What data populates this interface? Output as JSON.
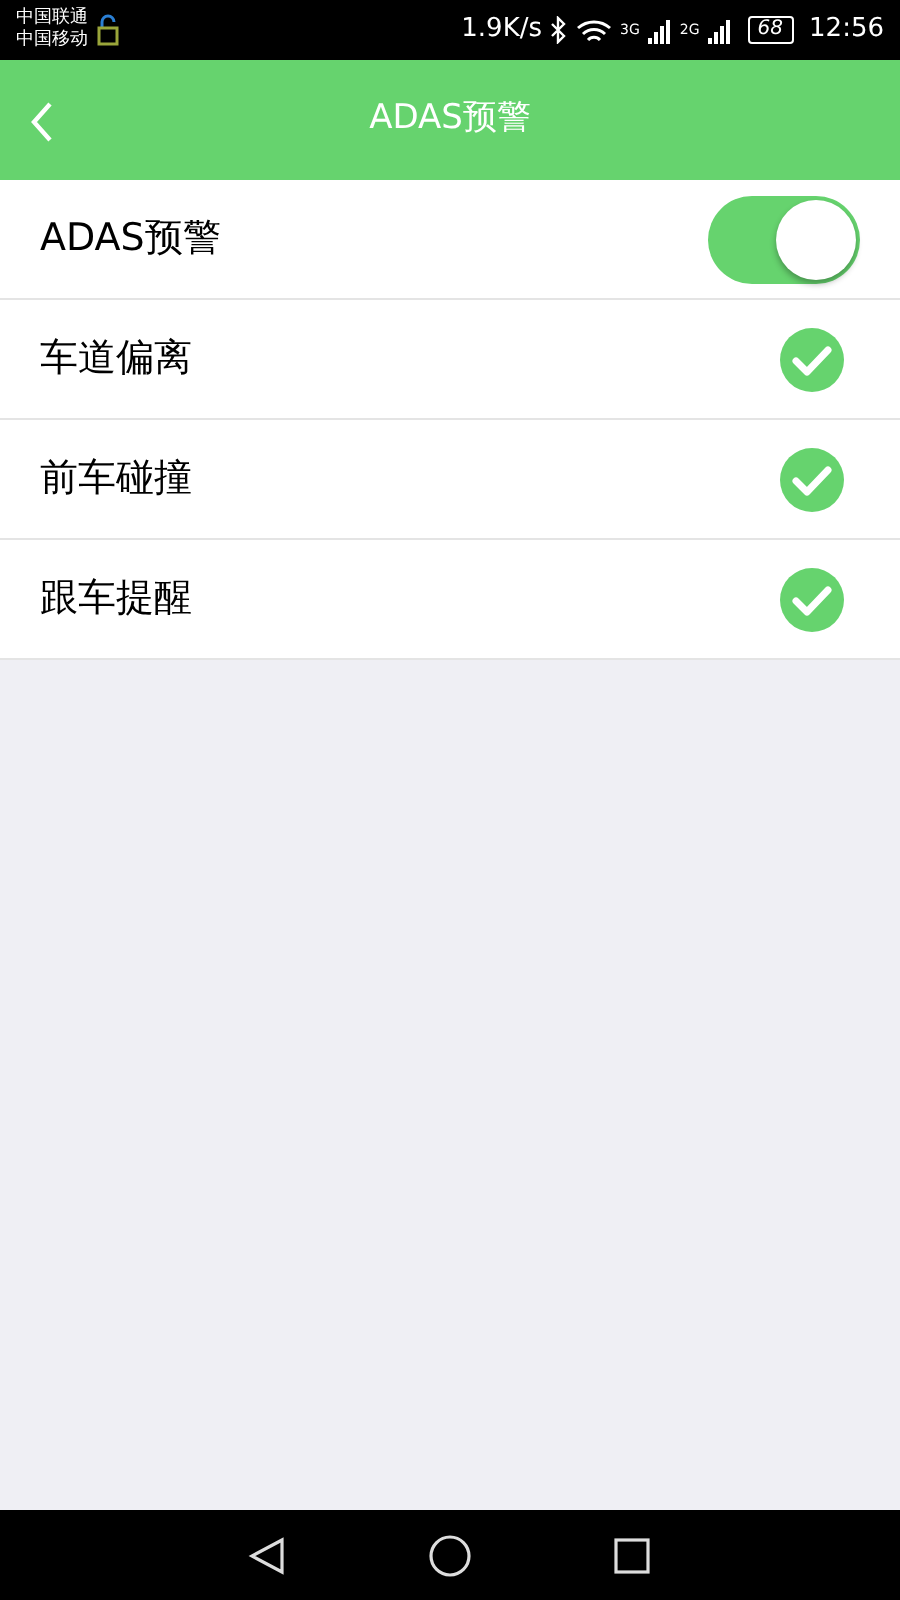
{
  "status_bar": {
    "carriers": [
      "中国联通",
      "中国移动"
    ],
    "speed": "1.9K/s",
    "networks": [
      {
        "label": "3G"
      },
      {
        "label": "2G"
      }
    ],
    "battery": "68",
    "time": "12:56"
  },
  "header": {
    "title": "ADAS预警"
  },
  "items": [
    {
      "kind": "switch",
      "label": "ADAS预警",
      "on": true
    },
    {
      "kind": "check",
      "label": "车道偏离",
      "checked": true
    },
    {
      "kind": "check",
      "label": "前车碰撞",
      "checked": true
    },
    {
      "kind": "check",
      "label": "跟车提醒",
      "checked": true
    }
  ]
}
